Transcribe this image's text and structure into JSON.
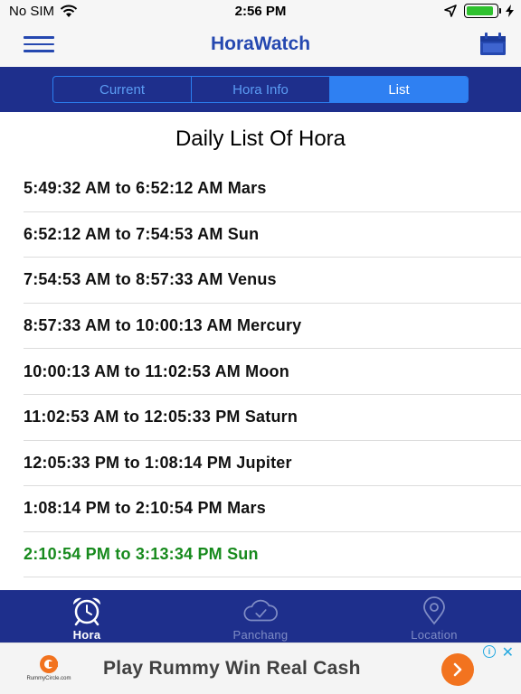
{
  "status_bar": {
    "carrier": "No SIM",
    "time": "2:56 PM",
    "battery_level": 0.9
  },
  "nav": {
    "title": "HoraWatch",
    "menu_icon": "hamburger-menu-icon",
    "calendar_icon": "calendar-icon"
  },
  "segments": [
    {
      "label": "Current",
      "active": false
    },
    {
      "label": "Hora Info",
      "active": false
    },
    {
      "label": "List",
      "active": true
    }
  ],
  "list": {
    "title": "Daily List Of Hora",
    "items": [
      {
        "text": "5:49:32 AM to 6:52:12 AM Mars"
      },
      {
        "text": "6:52:12 AM to 7:54:53 AM Sun"
      },
      {
        "text": "7:54:53 AM to 8:57:33 AM Venus"
      },
      {
        "text": "8:57:33 AM to 10:00:13 AM Mercury"
      },
      {
        "text": "10:00:13 AM to 11:02:53 AM Moon"
      },
      {
        "text": "11:02:53 AM to 12:05:33 PM Saturn"
      },
      {
        "text": "12:05:33 PM to 1:08:14 PM Jupiter"
      },
      {
        "text": "1:08:14 PM to 2:10:54 PM Mars"
      },
      {
        "text": "2:10:54 PM to 3:13:34 PM Sun",
        "current": true
      }
    ]
  },
  "tab_bar": {
    "items": [
      {
        "label": "Hora",
        "icon": "alarm-clock-icon",
        "active": true
      },
      {
        "label": "Panchang",
        "icon": "cloud-check-icon",
        "active": false
      },
      {
        "label": "Location",
        "icon": "location-pin-icon",
        "active": false
      }
    ]
  },
  "ad": {
    "brand": "RummyCircle.com",
    "text": "Play Rummy Win Real Cash"
  },
  "colors": {
    "brand_blue": "#1e2f8c",
    "title_blue": "#2548b0",
    "segment_active": "#2f80f2",
    "current_hora_green": "#178a1d",
    "ad_button_orange": "#f2731f"
  }
}
